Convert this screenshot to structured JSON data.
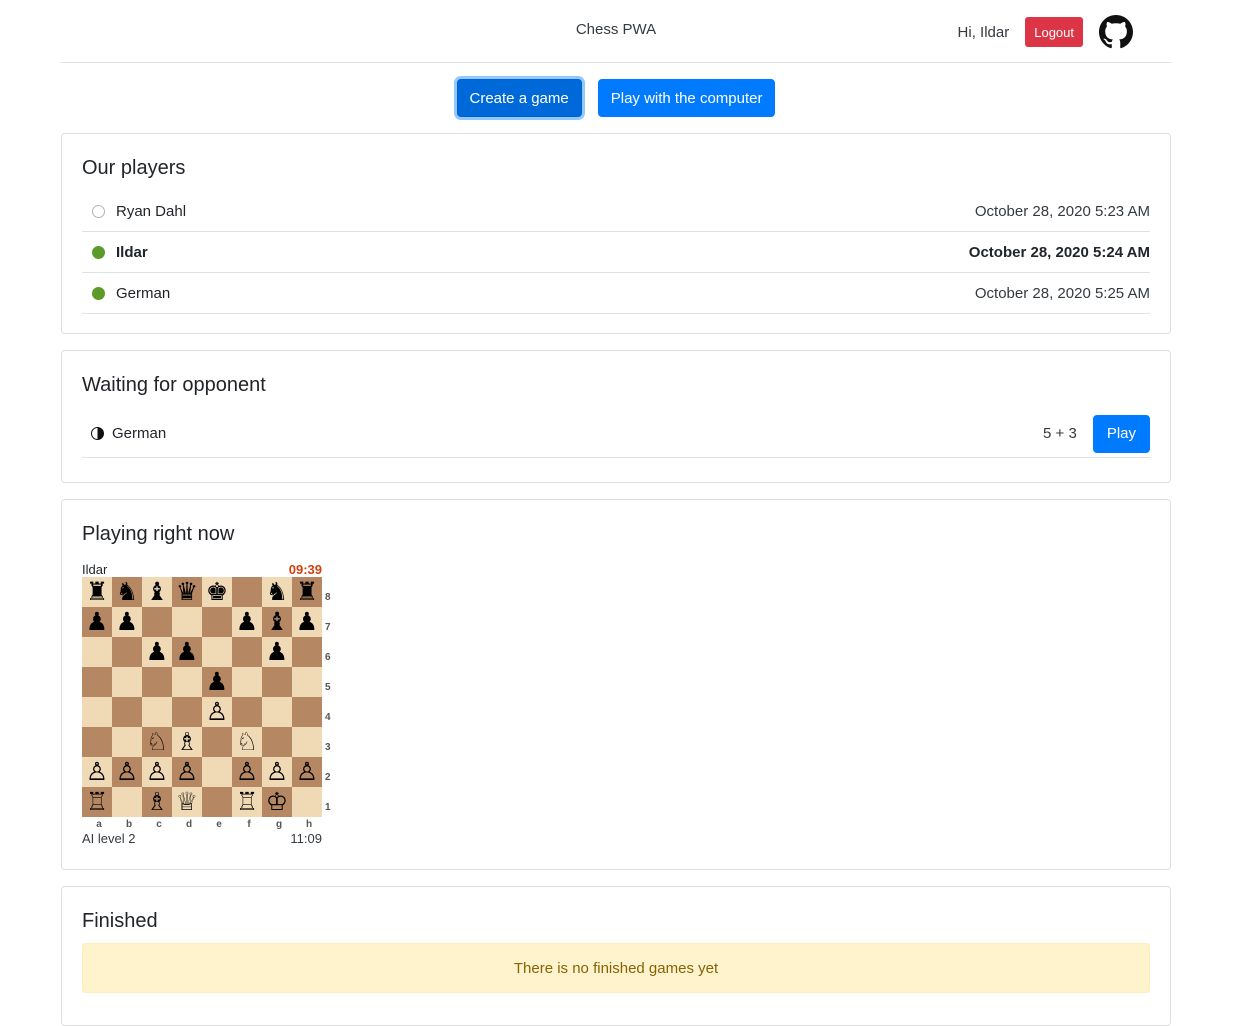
{
  "header": {
    "title": "Chess PWA",
    "greeting": "Hi, Ildar",
    "logout_label": "Logout",
    "github_icon": "github-icon"
  },
  "actions": {
    "create_label": "Create a game",
    "computer_label": "Play with the computer"
  },
  "players": {
    "title": "Our players",
    "items": [
      {
        "name": "Ryan Dahl",
        "time": "October 28, 2020 5:23 AM",
        "online": false,
        "current": false
      },
      {
        "name": "Ildar",
        "time": "October 28, 2020 5:24 AM",
        "online": true,
        "current": true
      },
      {
        "name": "German",
        "time": "October 28, 2020 5:25 AM",
        "online": true,
        "current": false
      }
    ]
  },
  "waiting": {
    "title": "Waiting for opponent",
    "items": [
      {
        "name": "German",
        "control": "5 + 3",
        "play_label": "Play",
        "color_icon": "half-moon-icon"
      }
    ]
  },
  "playing": {
    "title": "Playing right now",
    "games": [
      {
        "top_player": "Ildar",
        "top_clock": "09:39",
        "bottom_player": "AI level 2",
        "bottom_clock": "11:09",
        "ranks": [
          "8",
          "7",
          "6",
          "5",
          "4",
          "3",
          "2",
          "1"
        ],
        "files": [
          "a",
          "b",
          "c",
          "d",
          "e",
          "f",
          "g",
          "h"
        ],
        "position": [
          [
            "♜",
            "♞",
            "♝",
            "♛",
            "♚",
            "",
            "♞",
            "♜"
          ],
          [
            "♟",
            "♟",
            "",
            "",
            "",
            "♟",
            "♝",
            "♟"
          ],
          [
            "",
            "",
            "♟",
            "♟",
            "",
            "",
            "♟",
            ""
          ],
          [
            "",
            "",
            "",
            "",
            "♟",
            "",
            "",
            ""
          ],
          [
            "",
            "",
            "",
            "",
            "♙",
            "",
            "",
            ""
          ],
          [
            "",
            "",
            "♘",
            "♗",
            "",
            "♘",
            "",
            ""
          ],
          [
            "♙",
            "♙",
            "♙",
            "♙",
            "",
            "♙",
            "♙",
            "♙"
          ],
          [
            "♖",
            "",
            "♗",
            "♕",
            "",
            "♖",
            "♔",
            ""
          ]
        ]
      }
    ]
  },
  "finished": {
    "title": "Finished",
    "empty_message": "There is no finished games yet"
  },
  "colors": {
    "primary": "#007bff",
    "danger": "#dc3545",
    "online": "#5c9a2a",
    "board_light": "#f0d9b5",
    "board_dark": "#b58863",
    "clock_active": "#d1400b"
  }
}
